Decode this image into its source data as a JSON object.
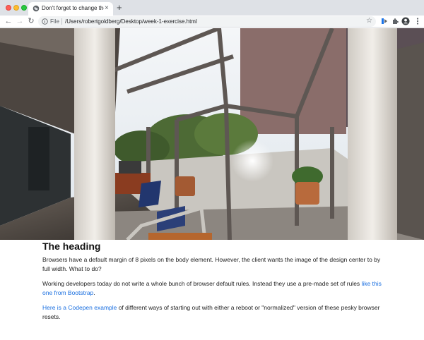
{
  "browser": {
    "tab_title": "Don't forget to change the title",
    "tab_close": "×",
    "new_tab": "+",
    "scheme_label": "File",
    "url": "/Users/robertgoldberg/Desktop/week-1-exercise.html",
    "nav": {
      "back": "←",
      "forward": "→",
      "reload": "↻"
    },
    "star": "☆"
  },
  "colors": {
    "link": "#1a6fe0",
    "tabstrip": "#dee1e6",
    "traffic_red": "#ff5f57",
    "traffic_yellow": "#febc2e",
    "traffic_green": "#28c840"
  },
  "page": {
    "hero_image": "photo of a sunlit atrium corridor with glass walls, columns, office chairs and a desk",
    "heading": "The heading",
    "p1": "Browsers have a default margin of 8 pixels on the body element. However, the client wants the image of the design center to by full width. What to do?",
    "p2_text": "Working developers today do not write a whole bunch of browser default rules. Instead they use a pre-made set of rules ",
    "p2_link": "like this one from Bootstrap",
    "p2_end": ".",
    "p3_link": "Here is a Codepen example",
    "p3_text": " of different ways of starting out with either a reboot or \"normalized\" version of these pesky browser resets."
  }
}
